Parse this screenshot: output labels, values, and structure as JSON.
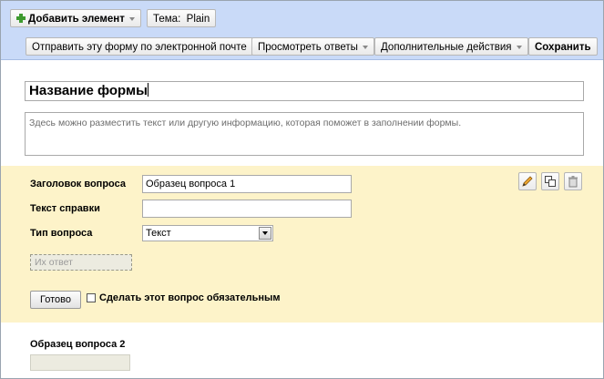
{
  "toolbar": {
    "add_item_label": "Добавить элемент",
    "theme_label": "Тема:",
    "theme_value": "Plain",
    "email_form_label": "Отправить эту форму по электронной почте",
    "view_responses_label": "Просмотреть ответы",
    "more_actions_label": "Дополнительные действия",
    "save_label": "Сохранить"
  },
  "form": {
    "title": "Название формы",
    "description": "Здесь можно разместить текст или другую информацию, которая поможет в заполнении формы."
  },
  "question_editor": {
    "title_label": "Заголовок вопроса",
    "title_value": "Образец вопроса 1",
    "help_label": "Текст справки",
    "help_value": "",
    "type_label": "Тип вопроса",
    "type_value": "Текст",
    "answer_placeholder": "Их ответ",
    "done_label": "Готово",
    "required_label": "Сделать этот вопрос обязательным",
    "required_checked": false
  },
  "next_question": {
    "title": "Образец вопроса 2"
  },
  "colors": {
    "header_bg": "#c9daf8",
    "editor_bg": "#fdf3c9"
  }
}
